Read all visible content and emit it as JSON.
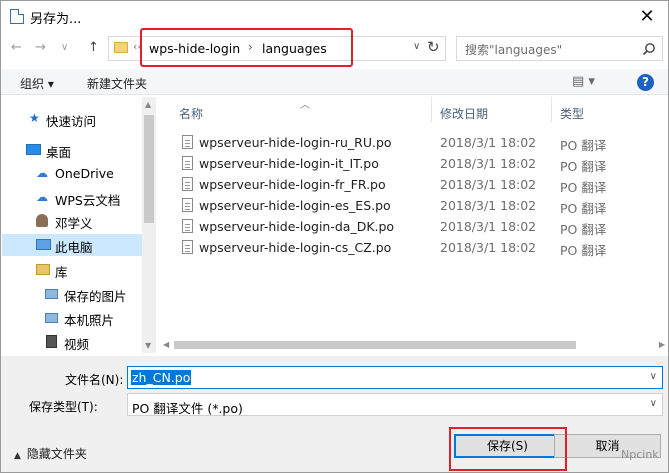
{
  "window": {
    "title": "另存为..."
  },
  "nav": {
    "back": "←",
    "forward": "→",
    "dropdown": "∨",
    "up": "↑"
  },
  "address": {
    "overflow": "‹‹",
    "segments": [
      "wps-hide-login",
      "languages"
    ],
    "separator": "›"
  },
  "search": {
    "placeholder": "搜索\"languages\""
  },
  "toolbar": {
    "organize": "组织 ▾",
    "new_folder": "新建文件夹",
    "help": "?"
  },
  "sidebar": {
    "items": [
      {
        "label": "快速访问",
        "icon": "star-icon"
      },
      {
        "label": "桌面",
        "icon": "desktop-icon"
      },
      {
        "label": "OneDrive",
        "icon": "cloud-icon"
      },
      {
        "label": "WPS云文档",
        "icon": "cloud-icon"
      },
      {
        "label": "邓学义",
        "icon": "user-icon"
      },
      {
        "label": "此电脑",
        "icon": "computer-icon"
      },
      {
        "label": "库",
        "icon": "library-icon"
      },
      {
        "label": "保存的图片",
        "icon": "pictures-icon"
      },
      {
        "label": "本机照片",
        "icon": "pictures-icon"
      },
      {
        "label": "视频",
        "icon": "video-icon"
      }
    ]
  },
  "columns": {
    "name": "名称",
    "date": "修改日期",
    "type": "类型"
  },
  "files": [
    {
      "name": "wpserveur-hide-login-ru_RU.po",
      "date": "2018/3/1 18:02",
      "type": "PO 翻译"
    },
    {
      "name": "wpserveur-hide-login-it_IT.po",
      "date": "2018/3/1 18:02",
      "type": "PO 翻译"
    },
    {
      "name": "wpserveur-hide-login-fr_FR.po",
      "date": "2018/3/1 18:02",
      "type": "PO 翻译"
    },
    {
      "name": "wpserveur-hide-login-es_ES.po",
      "date": "2018/3/1 18:02",
      "type": "PO 翻译"
    },
    {
      "name": "wpserveur-hide-login-da_DK.po",
      "date": "2018/3/1 18:02",
      "type": "PO 翻译"
    },
    {
      "name": "wpserveur-hide-login-cs_CZ.po",
      "date": "2018/3/1 18:02",
      "type": "PO 翻译"
    }
  ],
  "form": {
    "filename_label": "文件名(N):",
    "filename_value": "zh_CN.po",
    "filetype_label": "保存类型(T):",
    "filetype_value": "PO 翻译文件 (*.po)"
  },
  "footer": {
    "hide_folders": "隐藏文件夹",
    "save": "保存(S)",
    "cancel": "取消",
    "watermark": "Npcink"
  },
  "colors": {
    "accent": "#0078d7",
    "highlight": "#e0202c",
    "selected": "#cce8ff"
  }
}
